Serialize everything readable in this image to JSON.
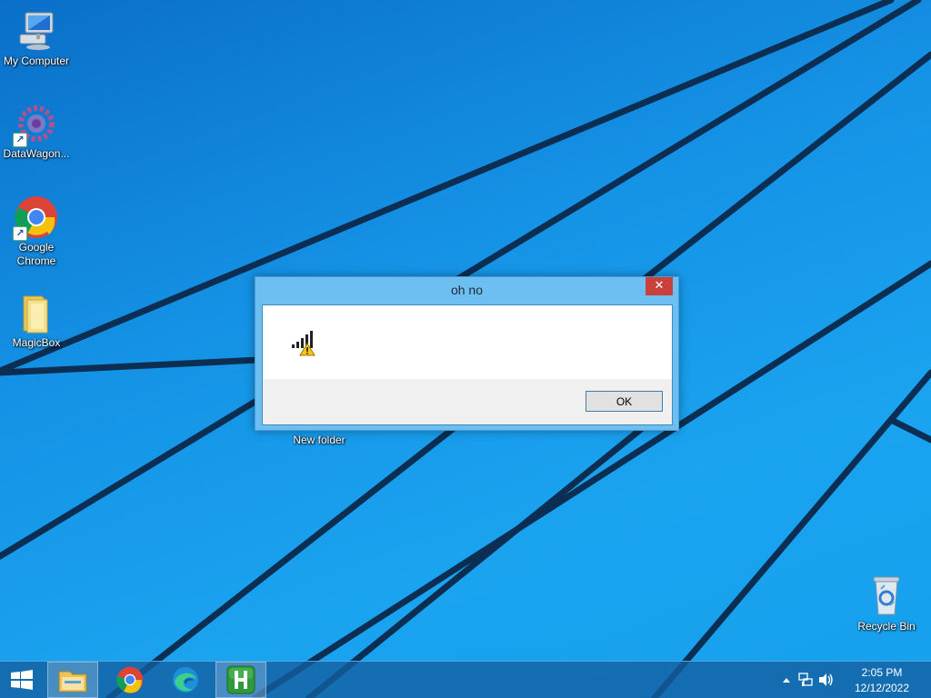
{
  "desktop": {
    "icons": [
      {
        "label": "My Computer"
      },
      {
        "label": "DataWagon..."
      },
      {
        "label": "Google Chrome"
      },
      {
        "label": "MagicBox"
      },
      {
        "label": "New folder"
      },
      {
        "label": "Recycle Bin"
      }
    ]
  },
  "dialog": {
    "title": "oh no",
    "close_label": "✕",
    "ok_label": "OK",
    "icon": "signal-warning-icon"
  },
  "taskbar": {
    "buttons": [
      "start-icon",
      "file-explorer-icon",
      "chrome-icon",
      "edge-icon",
      "h-app-icon"
    ],
    "active": "h-app-icon",
    "tray_icons": [
      "show-hidden-icons-chevron",
      "network-icon",
      "volume-icon"
    ],
    "clock": {
      "time": "2:05 PM",
      "date": "12/12/2022"
    }
  },
  "colors": {
    "wallpaper": "#1593e6",
    "dialog_frame": "#6cbff0",
    "close_button": "#c9413a",
    "taskbar": "#145fa0"
  }
}
